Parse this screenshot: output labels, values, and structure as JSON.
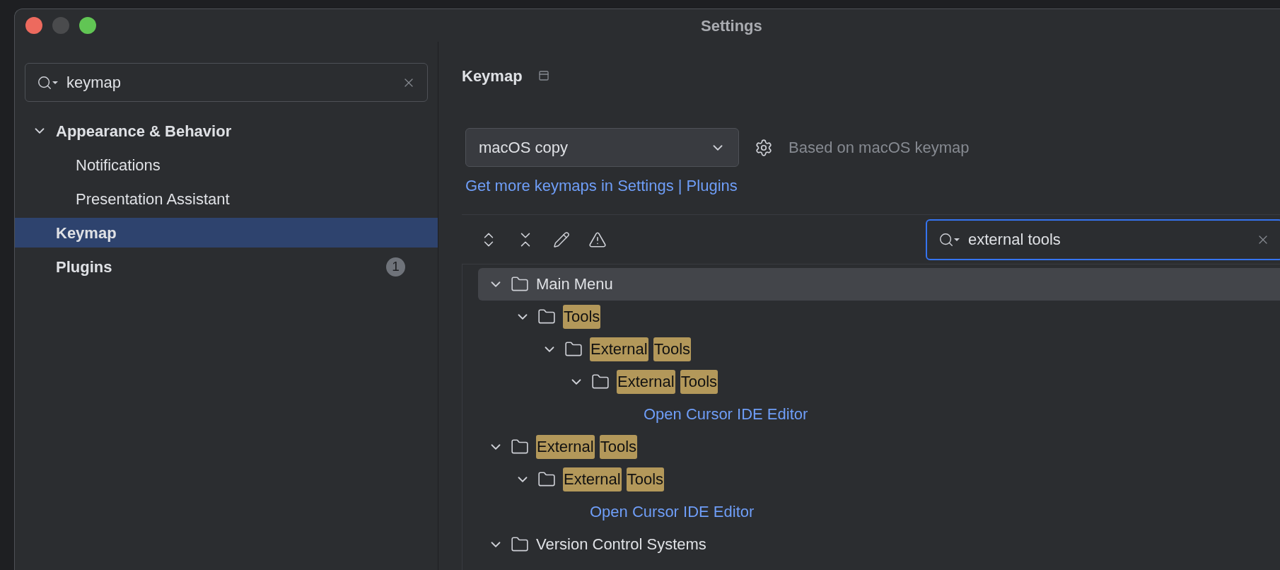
{
  "window": {
    "title": "Settings"
  },
  "sidebar": {
    "search": {
      "value": "keymap"
    },
    "items": [
      {
        "label": "Appearance & Behavior",
        "expanded": true,
        "selected": false,
        "children": [
          {
            "label": "Notifications",
            "selected": false
          },
          {
            "label": "Presentation Assistant",
            "selected": false
          }
        ]
      },
      {
        "label": "Keymap",
        "selected": true
      },
      {
        "label": "Plugins",
        "selected": false,
        "badge": "1"
      }
    ]
  },
  "content": {
    "title": "Keymap",
    "keymap_select": {
      "value": "macOS copy"
    },
    "based_on": "Based on macOS keymap",
    "link": "Get more keymaps in Settings | Plugins",
    "search": {
      "value": "external tools"
    },
    "tree": [
      {
        "kind": "folder",
        "expanded": true,
        "selected": true,
        "words": [
          {
            "text": "Main Menu",
            "highlighted": false
          }
        ],
        "children": [
          {
            "kind": "folder",
            "expanded": true,
            "selected": false,
            "words": [
              {
                "text": "Tools",
                "highlighted": true
              }
            ],
            "children": [
              {
                "kind": "folder",
                "expanded": true,
                "selected": false,
                "words": [
                  {
                    "text": "External",
                    "highlighted": true
                  },
                  {
                    "text": "Tools",
                    "highlighted": true
                  }
                ],
                "children": [
                  {
                    "kind": "folder",
                    "expanded": true,
                    "selected": false,
                    "words": [
                      {
                        "text": "External",
                        "highlighted": true
                      },
                      {
                        "text": "Tools",
                        "highlighted": true
                      }
                    ],
                    "children": [
                      {
                        "kind": "action",
                        "selected": false,
                        "words": [
                          {
                            "text": "Open Cursor IDE Editor",
                            "highlighted": false
                          }
                        ]
                      }
                    ]
                  }
                ]
              }
            ]
          }
        ]
      },
      {
        "kind": "folder",
        "expanded": true,
        "selected": false,
        "words": [
          {
            "text": "External",
            "highlighted": true
          },
          {
            "text": "Tools",
            "highlighted": true
          }
        ],
        "children": [
          {
            "kind": "folder",
            "expanded": true,
            "selected": false,
            "words": [
              {
                "text": "External",
                "highlighted": true
              },
              {
                "text": "Tools",
                "highlighted": true
              }
            ],
            "children": [
              {
                "kind": "action",
                "selected": false,
                "words": [
                  {
                    "text": "Open Cursor IDE Editor",
                    "highlighted": false
                  }
                ]
              }
            ]
          }
        ]
      },
      {
        "kind": "folder",
        "expanded": true,
        "selected": false,
        "words": [
          {
            "text": "Version Control Systems",
            "highlighted": false
          }
        ]
      }
    ]
  }
}
